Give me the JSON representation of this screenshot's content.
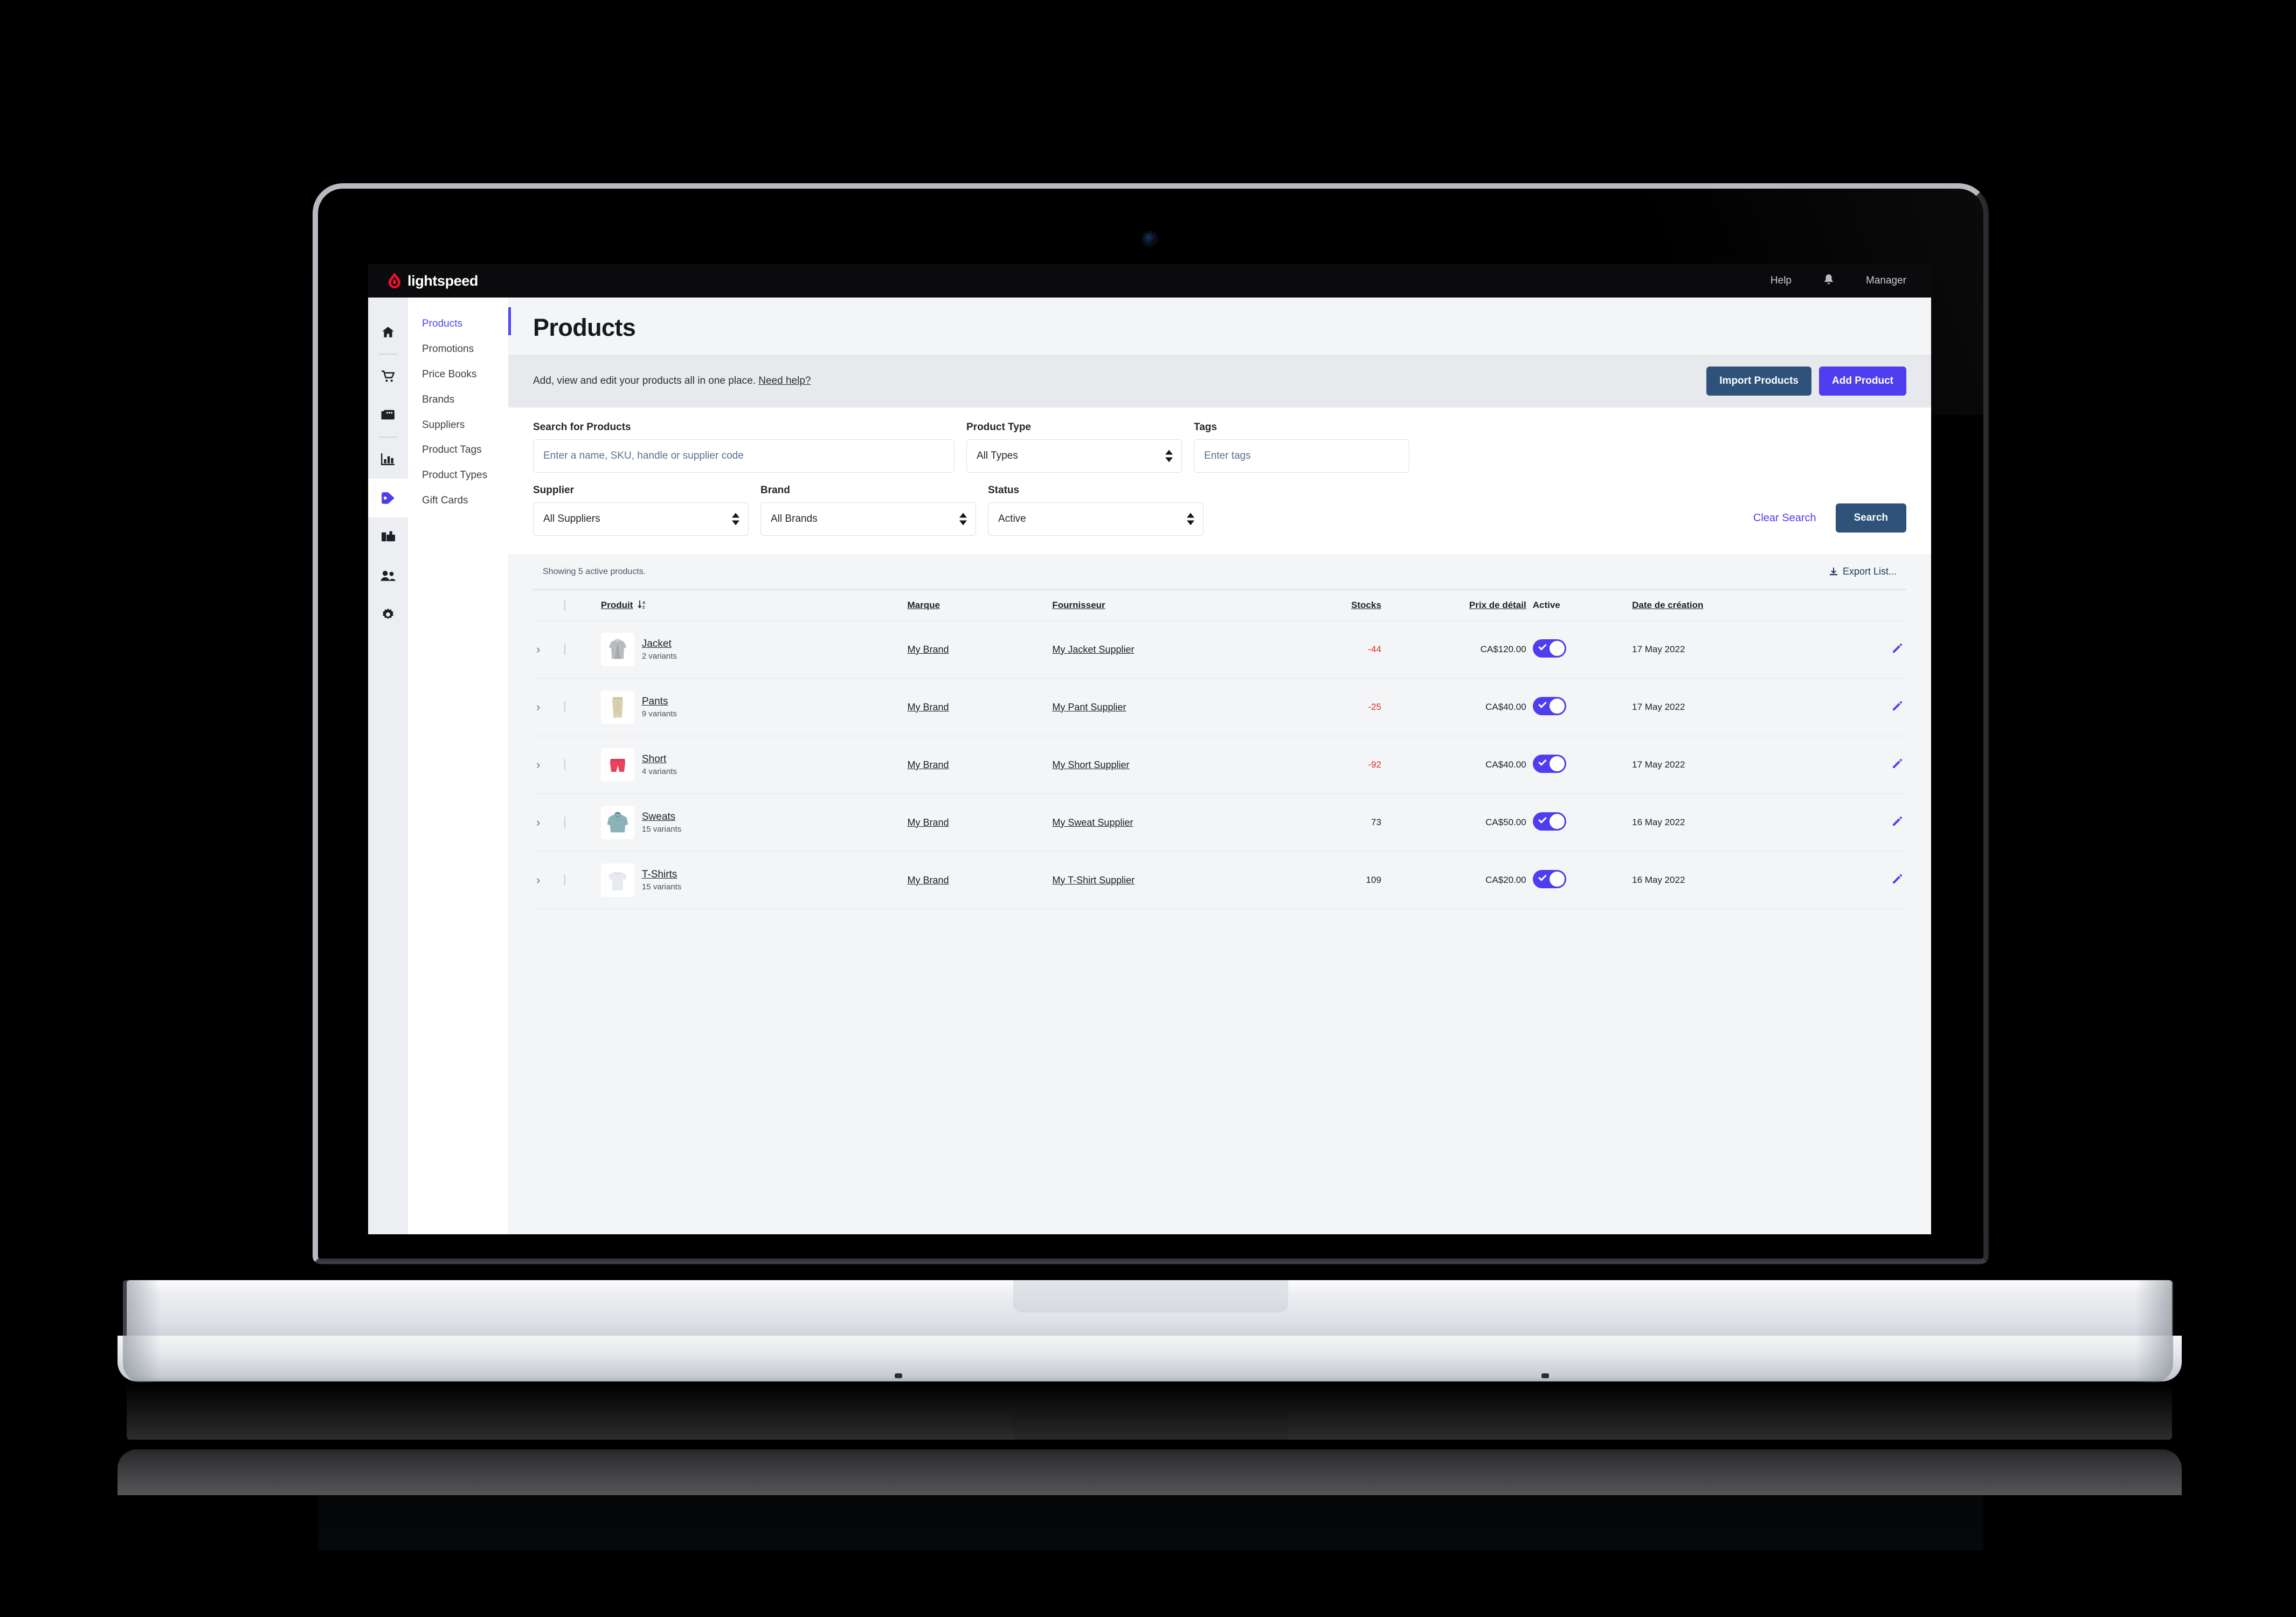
{
  "app": {
    "brand_name": "lightspeed",
    "topbar": {
      "help_label": "Help",
      "notifications_icon": "bell-icon",
      "user_label": "Manager"
    }
  },
  "rail": {
    "items": [
      {
        "icon": "home-icon",
        "name": "home"
      },
      {
        "icon": "cart-icon",
        "name": "sell"
      },
      {
        "icon": "register-icon",
        "name": "register"
      },
      {
        "icon": "chart-icon",
        "name": "reporting"
      },
      {
        "icon": "tag-icon",
        "name": "catalog",
        "active": true
      },
      {
        "icon": "product-types-icon",
        "name": "inventory"
      },
      {
        "icon": "people-icon",
        "name": "customers"
      },
      {
        "icon": "gear-icon",
        "name": "setup"
      }
    ]
  },
  "subnav": {
    "items": [
      {
        "label": "Products",
        "active": true
      },
      {
        "label": "Promotions",
        "active": false
      },
      {
        "label": "Price Books",
        "active": false
      },
      {
        "label": "Brands",
        "active": false
      },
      {
        "label": "Suppliers",
        "active": false
      },
      {
        "label": "Product Tags",
        "active": false
      },
      {
        "label": "Product Types",
        "active": false
      },
      {
        "label": "Gift Cards",
        "active": false
      }
    ]
  },
  "page": {
    "title": "Products",
    "description": "Add, view and edit your products all in one place.",
    "help_link": "Need help?",
    "import_label": "Import Products",
    "add_label": "Add Product"
  },
  "filters": {
    "search_label": "Search for Products",
    "search_placeholder": "Enter a name, SKU, handle or supplier code",
    "search_value": "",
    "product_type_label": "Product Type",
    "product_type_value": "All Types",
    "tags_label": "Tags",
    "tags_placeholder": "Enter tags",
    "tags_value": "",
    "supplier_label": "Supplier",
    "supplier_value": "All Suppliers",
    "brand_label": "Brand",
    "brand_value": "All Brands",
    "status_label": "Status",
    "status_value": "Active",
    "clear_label": "Clear Search",
    "search_button_label": "Search"
  },
  "table": {
    "showing": "Showing 5 active products.",
    "export_label": "Export List...",
    "export_icon": "download-icon",
    "sort_icon": "sort-az-descending-icon",
    "columns": {
      "product": "Produit",
      "brand": "Marque",
      "supplier": "Fournisseur",
      "stock": "Stocks",
      "price": "Prix de détail",
      "active": "Active",
      "created": "Date de création"
    },
    "rows": [
      {
        "thumb": "jacket",
        "name": "Jacket",
        "variants": "2 variants",
        "brand": "My Brand",
        "supplier": "My Jacket Supplier",
        "stock": "-44",
        "stock_negative": true,
        "price": "CA$120.00",
        "active": true,
        "created": "17 May 2022"
      },
      {
        "thumb": "pants",
        "name": "Pants",
        "variants": "9 variants",
        "brand": "My Brand",
        "supplier": "My Pant Supplier",
        "stock": "-25",
        "stock_negative": true,
        "price": "CA$40.00",
        "active": true,
        "created": "17 May 2022"
      },
      {
        "thumb": "short",
        "name": "Short",
        "variants": "4 variants",
        "brand": "My Brand",
        "supplier": "My Short Supplier",
        "stock": "-92",
        "stock_negative": true,
        "price": "CA$40.00",
        "active": true,
        "created": "17 May 2022"
      },
      {
        "thumb": "sweats",
        "name": "Sweats",
        "variants": "15 variants",
        "brand": "My Brand",
        "supplier": "My Sweat Supplier",
        "stock": "73",
        "stock_negative": false,
        "price": "CA$50.00",
        "active": true,
        "created": "16 May 2022"
      },
      {
        "thumb": "tshirt",
        "name": "T-Shirts",
        "variants": "15 variants",
        "brand": "My Brand",
        "supplier": "My T-Shirt Supplier",
        "stock": "109",
        "stock_negative": false,
        "price": "CA$20.00",
        "active": true,
        "created": "16 May 2022"
      }
    ]
  },
  "colors": {
    "brand_red": "#E8112D",
    "accent_purple": "#4F3DF0",
    "button_navy": "#2E5279",
    "negative_red": "#D93025",
    "topbar_black": "#0B0B0D"
  }
}
